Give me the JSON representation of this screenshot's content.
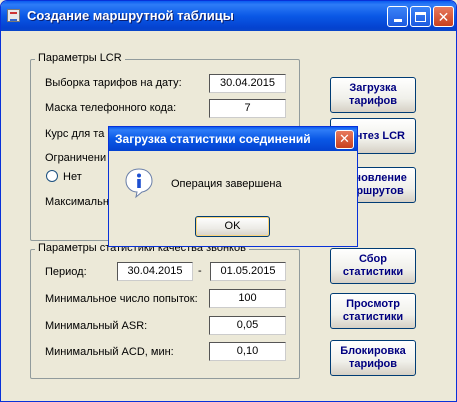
{
  "window": {
    "title": "Создание маршрутной таблицы"
  },
  "lcr_group": {
    "legend": "Параметры  LCR",
    "tariff_date_label": "Выборка тарифов на дату:",
    "tariff_date_value": "30.04.2015",
    "phone_mask_label": "Маска телефонного кода:",
    "phone_mask_value": "7",
    "rate_label": "Курс для та",
    "limit_label": "Ограничени",
    "radio_no_label": "Нет",
    "max_label": "Максимальн"
  },
  "stats_group": {
    "legend": "Параметры статистики качества звонков",
    "period_label": "Период:",
    "period_from": "30.04.2015",
    "period_sep": "-",
    "period_to": "01.05.2015",
    "min_attempts_label": "Минимальное число попыток:",
    "min_attempts_value": "100",
    "min_asr_label": "Минимальный ASR:",
    "min_asr_value": "0,05",
    "min_acd_label": "Минимальный ACD, мин:",
    "min_acd_value": "0,10"
  },
  "buttons": {
    "load_tariffs": "Загрузка тарифов",
    "synth_lcr": "Синтез LCR",
    "update_routes": "Обновление маршрутов",
    "collect_stats": "Сбор статистики",
    "view_stats": "Просмотр статистики",
    "block_tariffs": "Блокировка тарифов"
  },
  "dialog": {
    "title": "Загрузка статистики соединений",
    "message": "Операция завершена",
    "ok_label": "OK",
    "icon": "info-icon"
  },
  "colors": {
    "titlebar": "#0a58e6",
    "button_text": "#000080",
    "background": "#ece9d8"
  }
}
